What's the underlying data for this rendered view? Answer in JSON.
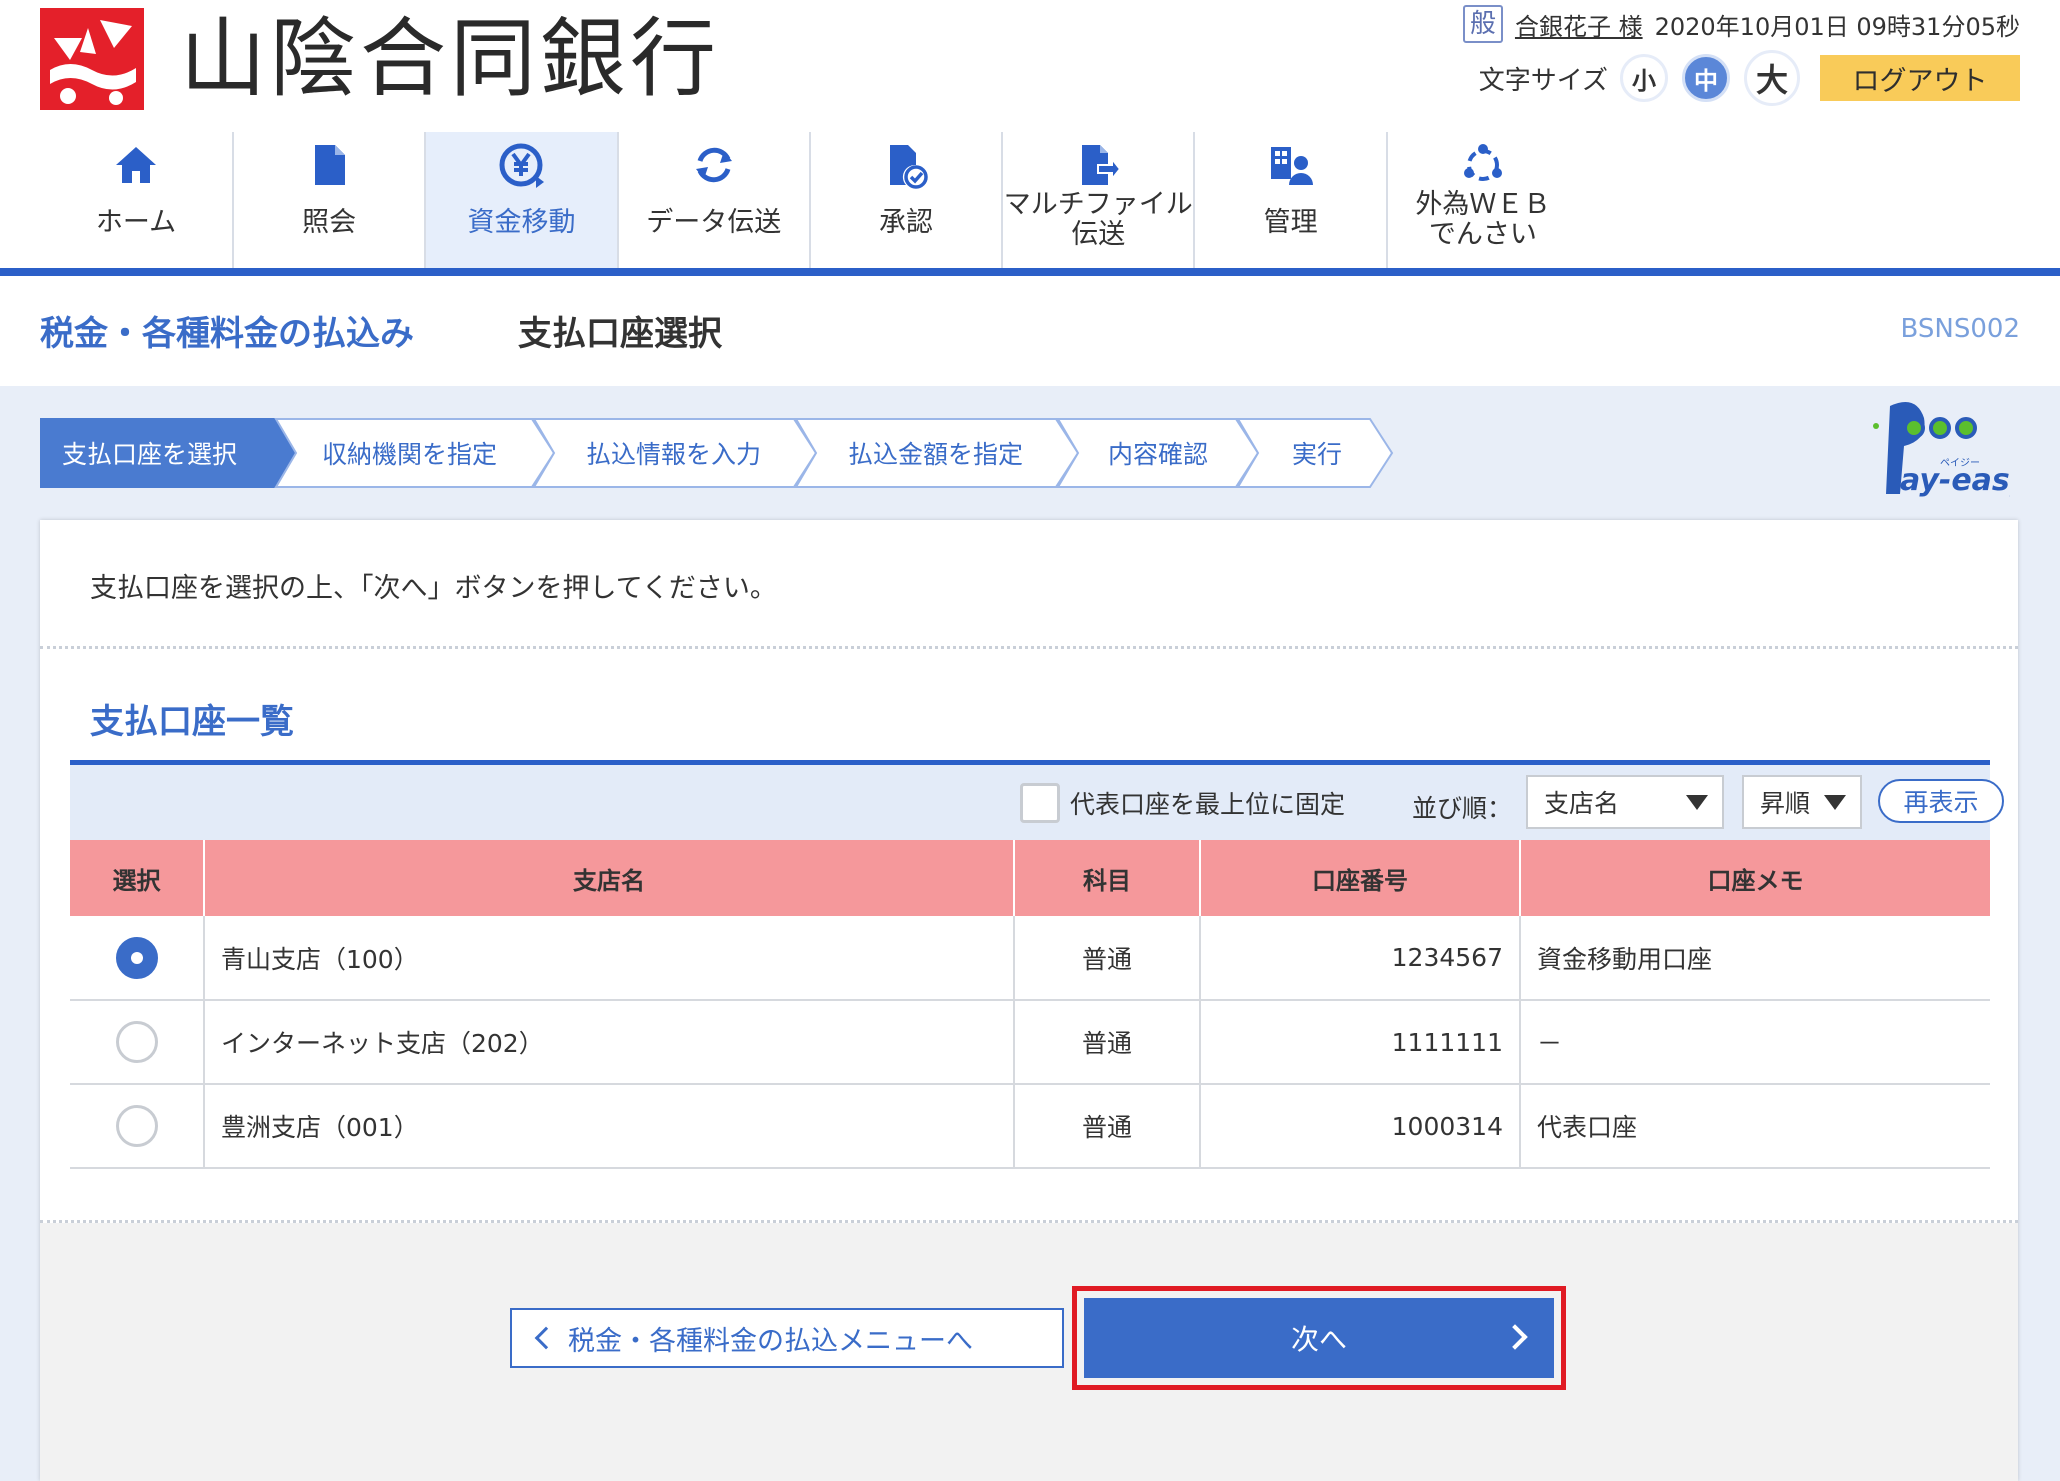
{
  "header": {
    "bank_name": "山陰合同銀行",
    "user_badge": "般",
    "user_name": "合銀花子 様",
    "datetime": "2020年10月01日 09時31分05秒",
    "font_size_label": "文字サイズ",
    "font_sizes": [
      "小",
      "中",
      "大"
    ],
    "active_font_size": "中",
    "logout": "ログアウト"
  },
  "nav": {
    "items": [
      {
        "label": "ホーム",
        "icon": "home-icon"
      },
      {
        "label": "照会",
        "icon": "document-icon"
      },
      {
        "label": "資金移動",
        "icon": "yen-transfer-icon",
        "active": true
      },
      {
        "label": "データ伝送",
        "icon": "sync-icon"
      },
      {
        "label": "承認",
        "icon": "approval-icon"
      },
      {
        "label": "マルチファイル伝送",
        "line1": "マルチファイル",
        "line2": "伝送",
        "icon": "file-transfer-icon"
      },
      {
        "label": "管理",
        "icon": "admin-icon"
      },
      {
        "label": "外為ＷＥＢでんさい",
        "line1": "外為ＷＥＢ",
        "line2": "でんさい",
        "icon": "network-icon"
      }
    ]
  },
  "page": {
    "title": "税金・各種料金の払込み",
    "subtitle": "支払口座選択",
    "code": "BSNS002"
  },
  "steps": [
    "支払口座を選択",
    "収納機関を指定",
    "払込情報を入力",
    "払込金額を指定",
    "内容確認",
    "実行"
  ],
  "payeasy_logo": "Pay-easy ペイジー",
  "instruction": "支払口座を選択の上、「次へ」ボタンを押してください。",
  "section_title": "支払口座一覧",
  "table_tools": {
    "pin_label": "代表口座を最上位に固定",
    "sort_label": "並び順：",
    "sort_key": "支店名",
    "sort_order": "昇順",
    "refresh": "再表示"
  },
  "table": {
    "headers": [
      "選択",
      "支店名",
      "科目",
      "口座番号",
      "口座メモ"
    ],
    "rows": [
      {
        "selected": true,
        "branch": "青山支店（100）",
        "type": "普通",
        "number": "1234567",
        "memo": "資金移動用口座"
      },
      {
        "selected": false,
        "branch": "インターネット支店（202）",
        "type": "普通",
        "number": "1111111",
        "memo": "－"
      },
      {
        "selected": false,
        "branch": "豊洲支店（001）",
        "type": "普通",
        "number": "1000314",
        "memo": "代表口座"
      }
    ]
  },
  "buttons": {
    "back": "税金・各種料金の払込メニューへ",
    "next": "次へ"
  },
  "colors": {
    "brand_blue": "#2b5fc8",
    "header_pink": "#f5989b",
    "logout_yellow": "#f9cb59",
    "highlight_red": "#e01b24",
    "logo_red": "#e4202a"
  }
}
